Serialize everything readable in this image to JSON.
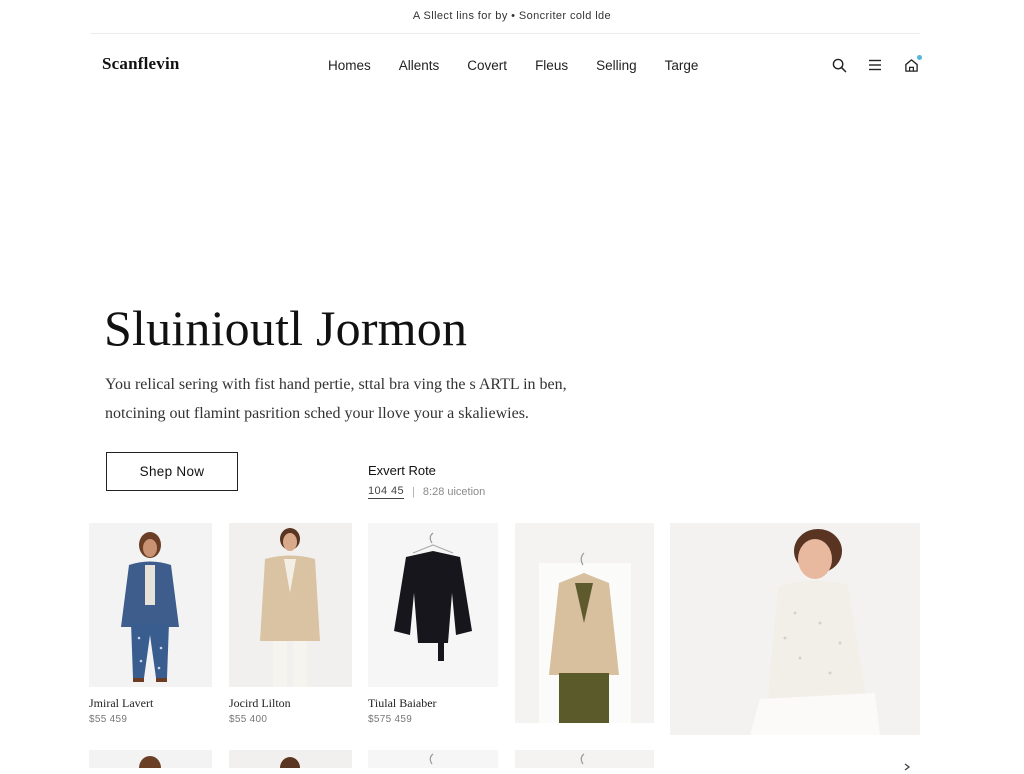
{
  "announcement": "A Sllect lins for by • Soncriter cold lde",
  "header": {
    "logo": "Scanflevin",
    "nav": [
      "Homes",
      "Allents",
      "Covert",
      "Fleus",
      "Selling",
      "Targe"
    ],
    "icons": [
      "search-icon",
      "menu-icon",
      "cart-icon"
    ],
    "accent": "#4fb8d8"
  },
  "hero": {
    "title": "Sluinioutl Jormon",
    "copy_line1": "You relical sering with fist hand pertie, sttal bra ving the s ARTL in ben,",
    "copy_line2": "notcining out flamint pasrition sched your llove your a skaliewies.",
    "button": "Shep Now"
  },
  "expert": {
    "title": "Exvert Rote",
    "number": "104 45",
    "separator": "|",
    "note": "8:28 uicetion"
  },
  "products": [
    {
      "name": "Jmiral Lavert",
      "price": "$55 459"
    },
    {
      "name": "Jocird Lilton",
      "price": "$55 400"
    },
    {
      "name": "Tiulal Baiaber",
      "price": "$575 459"
    }
  ],
  "next_icon": "chevron-right-icon"
}
